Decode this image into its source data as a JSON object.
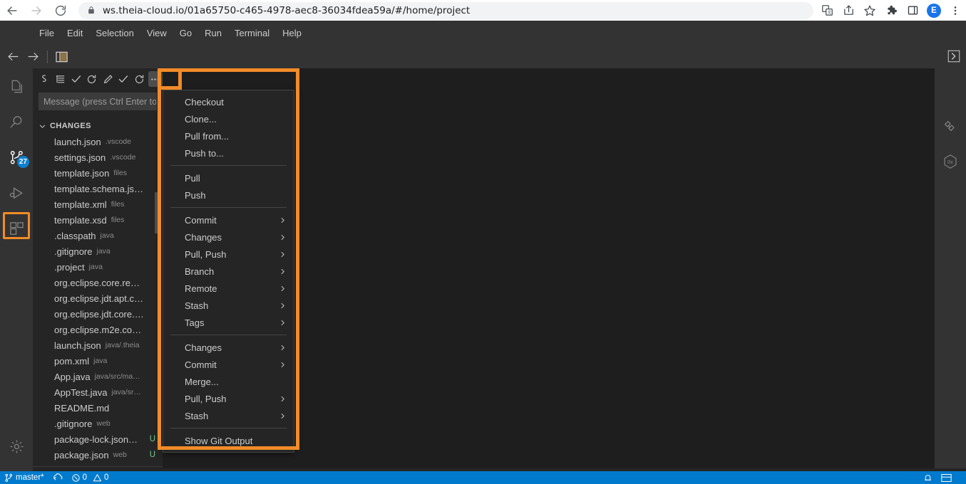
{
  "browser": {
    "url": "ws.theia-cloud.io/01a65750-c465-4978-aec8-36034fdea59a/#/home/project",
    "back_label": "Back",
    "forward_label": "Forward",
    "reload_label": "Reload",
    "lock_icon": "lock-icon",
    "actions": [
      {
        "name": "translate-icon",
        "label": "Translate"
      },
      {
        "name": "share-icon",
        "label": "Share"
      },
      {
        "name": "bookmark-star-icon",
        "label": "Bookmark this tab"
      },
      {
        "name": "extensions-puzzle-icon",
        "label": "Extensions"
      },
      {
        "name": "side-panel-icon",
        "label": "Side panel"
      }
    ],
    "profile_initial": "E",
    "more_label": "Customize and control"
  },
  "menubar": {
    "items": [
      "File",
      "Edit",
      "Selection",
      "View",
      "Go",
      "Run",
      "Terminal",
      "Help"
    ]
  },
  "topstrip": {
    "back": "go-back",
    "forward": "go-forward",
    "layout": "toggle-panel",
    "right_toggle": "open-right-panel"
  },
  "activitybar": {
    "items": [
      {
        "name": "explorer-icon",
        "label": "Explorer",
        "active": false,
        "badge": ""
      },
      {
        "name": "search-icon",
        "label": "Search",
        "active": false,
        "badge": ""
      },
      {
        "name": "source-control-icon",
        "label": "Source Control",
        "active": true,
        "badge": "27"
      },
      {
        "name": "run-debug-icon",
        "label": "Run and Debug",
        "active": false,
        "badge": ""
      },
      {
        "name": "extensions-icon",
        "label": "Extensions",
        "active": false,
        "badge": ""
      }
    ],
    "bottom": [
      {
        "name": "settings-gear-icon",
        "label": "Manage"
      }
    ]
  },
  "scm": {
    "toolbar": [
      {
        "name": "scm-provider-icon",
        "label": "$"
      },
      {
        "name": "view-as-tree-icon",
        "label": "View as Tree"
      },
      {
        "name": "commit-check-icon",
        "label": "Commit"
      },
      {
        "name": "refresh-icon",
        "label": "Refresh"
      },
      {
        "name": "edit-pencil-icon",
        "label": "Commit and Push"
      },
      {
        "name": "stage-check-icon",
        "label": "Stage All"
      },
      {
        "name": "discard-refresh-icon",
        "label": "Discard All"
      },
      {
        "name": "more-actions-icon",
        "label": "More Actions..."
      }
    ],
    "message_placeholder": "Message (press Ctrl Enter to commit)",
    "section_title": "CHANGES",
    "files": [
      {
        "name": "launch.json",
        "path": ".vscode",
        "status": ""
      },
      {
        "name": "settings.json",
        "path": ".vscode",
        "status": ""
      },
      {
        "name": "template.json",
        "path": "files",
        "status": ""
      },
      {
        "name": "template.schema.js…",
        "path": "",
        "status": ""
      },
      {
        "name": "template.xml",
        "path": "files",
        "status": ""
      },
      {
        "name": "template.xsd",
        "path": "files",
        "status": ""
      },
      {
        "name": ".classpath",
        "path": "java",
        "status": ""
      },
      {
        "name": ".gitignore",
        "path": "java",
        "status": ""
      },
      {
        "name": ".project",
        "path": "java",
        "status": ""
      },
      {
        "name": "org.eclipse.core.re…",
        "path": "",
        "status": ""
      },
      {
        "name": "org.eclipse.jdt.apt.c…",
        "path": "",
        "status": ""
      },
      {
        "name": "org.eclipse.jdt.core.…",
        "path": "",
        "status": ""
      },
      {
        "name": "org.eclipse.m2e.co…",
        "path": "",
        "status": ""
      },
      {
        "name": "launch.json",
        "path": "java/.theia",
        "status": ""
      },
      {
        "name": "pom.xml",
        "path": "java",
        "status": ""
      },
      {
        "name": "App.java",
        "path": "java/src/ma…",
        "status": ""
      },
      {
        "name": "AppTest.java",
        "path": "java/sr…",
        "status": ""
      },
      {
        "name": "README.md",
        "path": "",
        "status": ""
      },
      {
        "name": ".gitignore",
        "path": "web",
        "status": ""
      },
      {
        "name": "package-lock.json…",
        "path": "",
        "status": "U"
      },
      {
        "name": "package.json",
        "path": "web",
        "status": "U"
      }
    ]
  },
  "context_menu": {
    "groups": [
      {
        "items": [
          {
            "label": "Checkout",
            "submenu": false
          },
          {
            "label": "Clone...",
            "submenu": false
          },
          {
            "label": "Pull from...",
            "submenu": false
          },
          {
            "label": "Push to...",
            "submenu": false
          }
        ]
      },
      {
        "items": [
          {
            "label": "Pull",
            "submenu": false
          },
          {
            "label": "Push",
            "submenu": false
          }
        ]
      },
      {
        "items": [
          {
            "label": "Commit",
            "submenu": true
          },
          {
            "label": "Changes",
            "submenu": true
          },
          {
            "label": "Pull, Push",
            "submenu": true
          },
          {
            "label": "Branch",
            "submenu": true
          },
          {
            "label": "Remote",
            "submenu": true
          },
          {
            "label": "Stash",
            "submenu": true
          },
          {
            "label": "Tags",
            "submenu": true
          }
        ]
      },
      {
        "items": [
          {
            "label": "Changes",
            "submenu": true
          },
          {
            "label": "Commit",
            "submenu": true
          },
          {
            "label": "Merge...",
            "submenu": false
          },
          {
            "label": "Pull, Push",
            "submenu": true
          },
          {
            "label": "Stash",
            "submenu": true
          }
        ]
      },
      {
        "items": [
          {
            "label": "Show Git Output",
            "submenu": false
          }
        ]
      }
    ]
  },
  "rightbar": {
    "items": [
      {
        "name": "git-graph-icon",
        "label": "Git Graph"
      },
      {
        "name": "hex-0x-icon",
        "label": "0x"
      }
    ]
  },
  "statusbar": {
    "branch": "master*",
    "sync_label": "",
    "errors": "0",
    "warnings": "0",
    "right_items": [
      {
        "name": "notifications-bell-icon",
        "label": ""
      },
      {
        "name": "toggle-panel-icon",
        "label": ""
      }
    ]
  },
  "colors": {
    "accent_highlight": "#f28b28",
    "statusbar": "#007acc",
    "badge": "#0e80d0",
    "sidebar_bg": "#252526",
    "editor_bg": "#1e1e1e",
    "chrome_bg": "#333333"
  }
}
